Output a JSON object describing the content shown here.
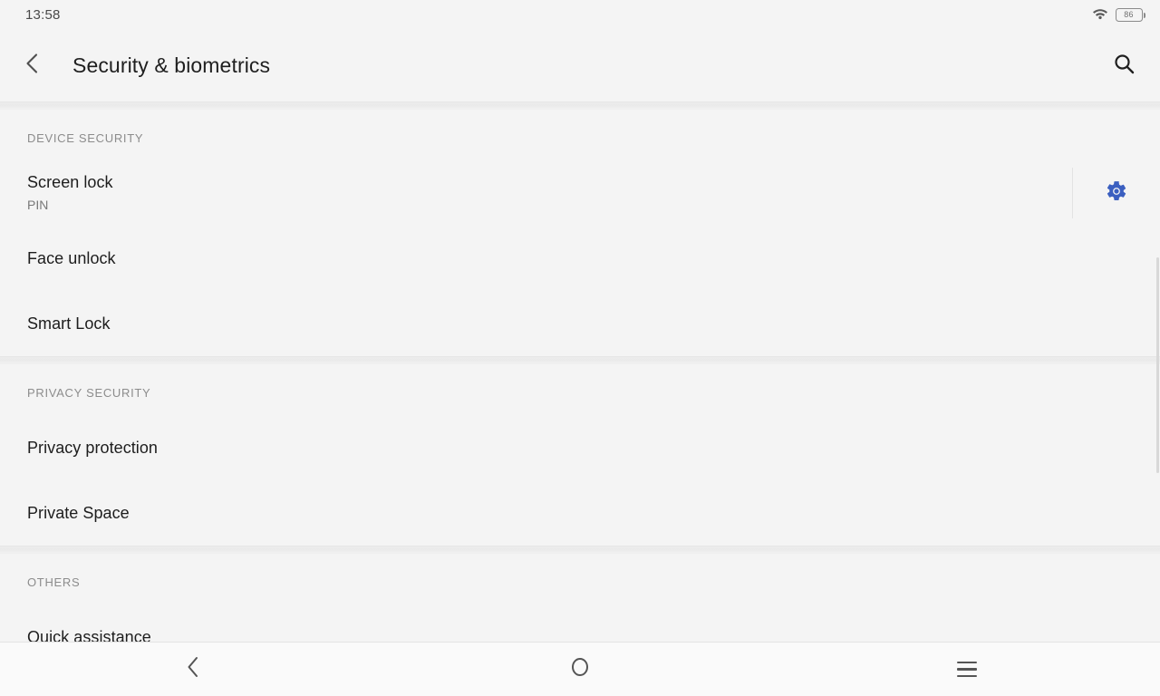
{
  "status_bar": {
    "time": "13:58",
    "wifi_icon": "wifi-icon",
    "battery_level": "86",
    "battery_icon": "battery-icon"
  },
  "app_bar": {
    "back_icon": "chevron-left-icon",
    "title": "Security & biometrics",
    "search_icon": "search-icon"
  },
  "sections": [
    {
      "header": "DEVICE SECURITY",
      "items": [
        {
          "title": "Screen lock",
          "subtitle": "PIN",
          "action_icon": "gear-icon"
        },
        {
          "title": "Face unlock",
          "subtitle": ""
        },
        {
          "title": "Smart Lock",
          "subtitle": ""
        }
      ]
    },
    {
      "header": "PRIVACY SECURITY",
      "items": [
        {
          "title": "Privacy protection",
          "subtitle": ""
        },
        {
          "title": "Private Space",
          "subtitle": ""
        }
      ]
    },
    {
      "header": "OTHERS",
      "items": [
        {
          "title": "Quick assistance",
          "subtitle": ""
        }
      ]
    }
  ],
  "nav_bar": {
    "back_icon": "nav-back-icon",
    "home_icon": "nav-home-icon",
    "recents_icon": "nav-recents-icon"
  },
  "colors": {
    "background": "#f4f4f4",
    "nav_background": "#fafafa",
    "accent_gear": "#3b5fc0",
    "title_text": "#1f1f1f",
    "section_header_text": "#8c8c8c",
    "subtitle_text": "#787878"
  }
}
